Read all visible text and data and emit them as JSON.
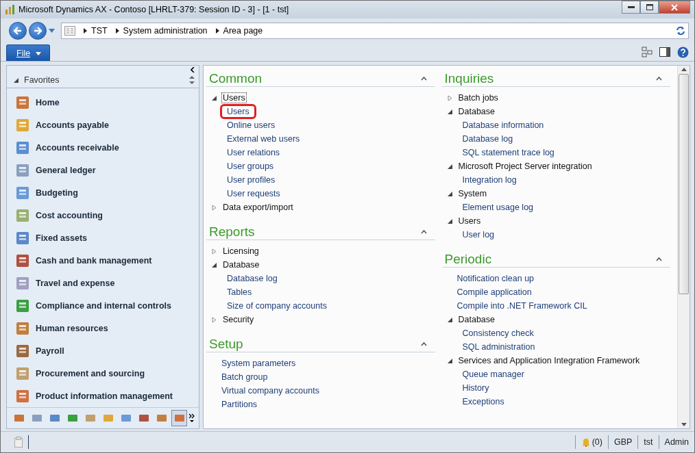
{
  "window": {
    "title": "Microsoft Dynamics AX - Contoso [LHRLT-379: Session ID - 3] -  [1 - tst]"
  },
  "breadcrumb": [
    "TST",
    "System administration",
    "Area page"
  ],
  "file_menu": {
    "label": "File"
  },
  "sidebar": {
    "header": "Favorites",
    "items": [
      {
        "label": "Home"
      },
      {
        "label": "Accounts payable"
      },
      {
        "label": "Accounts receivable"
      },
      {
        "label": "General ledger"
      },
      {
        "label": "Budgeting"
      },
      {
        "label": "Cost accounting"
      },
      {
        "label": "Fixed assets"
      },
      {
        "label": "Cash and bank management"
      },
      {
        "label": "Travel and expense"
      },
      {
        "label": "Compliance and internal controls"
      },
      {
        "label": "Human resources"
      },
      {
        "label": "Payroll"
      },
      {
        "label": "Procurement and sourcing"
      },
      {
        "label": "Product information management"
      }
    ],
    "module_buttons": [
      {
        "selected": false
      },
      {
        "selected": false
      },
      {
        "selected": false
      },
      {
        "selected": false
      },
      {
        "selected": false
      },
      {
        "selected": false
      },
      {
        "selected": false
      },
      {
        "selected": false
      },
      {
        "selected": false
      },
      {
        "selected": true
      }
    ]
  },
  "columns": [
    [
      {
        "title": "Common",
        "items": [
          {
            "kind": "group",
            "label": "Users",
            "expanded": true,
            "focused": true,
            "children": [
              {
                "label": "Users",
                "highlighted": true
              },
              {
                "label": "Online users",
                "highlighted": false
              },
              {
                "label": "External web users",
                "highlighted": false
              },
              {
                "label": "User relations",
                "highlighted": false
              },
              {
                "label": "User groups",
                "highlighted": false
              },
              {
                "label": "User profiles",
                "highlighted": false
              },
              {
                "label": "User requests",
                "highlighted": false
              }
            ]
          },
          {
            "kind": "group",
            "label": "Data export/import",
            "expanded": false,
            "focused": false
          }
        ]
      },
      {
        "title": "Reports",
        "items": [
          {
            "kind": "group",
            "label": "Licensing",
            "expanded": false,
            "focused": false
          },
          {
            "kind": "group",
            "label": "Database",
            "expanded": true,
            "focused": false,
            "children": [
              {
                "label": "Database log",
                "highlighted": false
              },
              {
                "label": "Tables",
                "highlighted": false
              },
              {
                "label": "Size of company accounts",
                "highlighted": false
              }
            ]
          },
          {
            "kind": "group",
            "label": "Security",
            "expanded": false,
            "focused": false
          }
        ]
      },
      {
        "title": "Setup",
        "items": [
          {
            "kind": "link",
            "label": "System parameters"
          },
          {
            "kind": "link",
            "label": "Batch group"
          },
          {
            "kind": "link",
            "label": "Virtual company accounts"
          },
          {
            "kind": "link",
            "label": "Partitions"
          }
        ]
      }
    ],
    [
      {
        "title": "Inquiries",
        "items": [
          {
            "kind": "group",
            "label": "Batch jobs",
            "expanded": false,
            "focused": false
          },
          {
            "kind": "group",
            "label": "Database",
            "expanded": true,
            "focused": false,
            "children": [
              {
                "label": "Database information",
                "highlighted": false
              },
              {
                "label": "Database log",
                "highlighted": false
              },
              {
                "label": "SQL statement trace log",
                "highlighted": false
              }
            ]
          },
          {
            "kind": "group",
            "label": "Microsoft Project Server integration",
            "expanded": true,
            "focused": false,
            "children": [
              {
                "label": "Integration log",
                "highlighted": false
              }
            ]
          },
          {
            "kind": "group",
            "label": "System",
            "expanded": true,
            "focused": false,
            "children": [
              {
                "label": "Element usage log",
                "highlighted": false
              }
            ]
          },
          {
            "kind": "group",
            "label": "Users",
            "expanded": true,
            "focused": false,
            "children": [
              {
                "label": "User log",
                "highlighted": false
              }
            ]
          }
        ]
      },
      {
        "title": "Periodic",
        "items": [
          {
            "kind": "link",
            "label": "Notification clean up"
          },
          {
            "kind": "link",
            "label": "Compile application"
          },
          {
            "kind": "link",
            "label": "Compile into .NET Framework CIL"
          },
          {
            "kind": "group",
            "label": "Database",
            "expanded": true,
            "focused": false,
            "children": [
              {
                "label": "Consistency check",
                "highlighted": false
              },
              {
                "label": "SQL administration",
                "highlighted": false
              }
            ]
          },
          {
            "kind": "group",
            "label": "Services and Application Integration Framework",
            "expanded": true,
            "focused": false,
            "children": [
              {
                "label": "Queue manager",
                "highlighted": false
              },
              {
                "label": "History",
                "highlighted": false
              },
              {
                "label": "Exceptions",
                "highlighted": false
              }
            ]
          }
        ]
      }
    ]
  ],
  "status_bar": {
    "alerts": "(0)",
    "currency": "GBP",
    "company": "tst",
    "role": "Admin"
  }
}
